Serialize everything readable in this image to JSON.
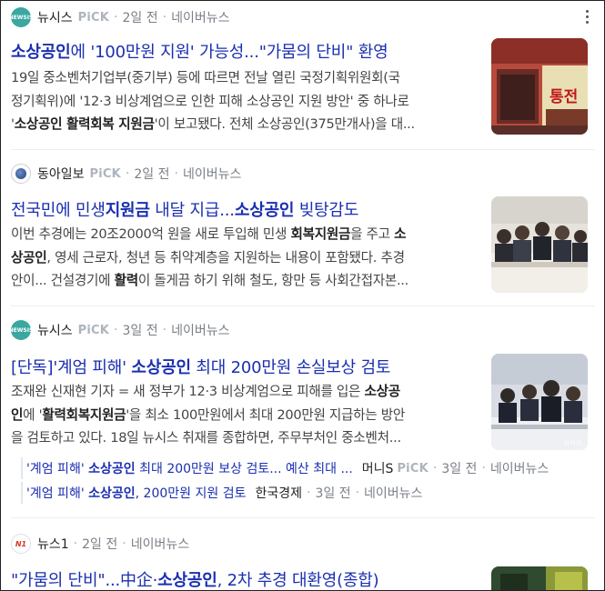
{
  "items": [
    {
      "press": "뉴시스",
      "pick": "PiCK",
      "time": "2일 전",
      "platform": "네이버뉴스",
      "title_parts": [
        "소상공인",
        "에 '100만원 지원' 가능성...\"가뭄의 단비\" 환영"
      ],
      "desc_lines": [
        [
          "19일 중소벤처기업부(중기부) 등에 따르면 전날 열린 국정기획위원회(국"
        ],
        [
          "정기획위)에 '12·3 비상계엄으로 인한 피해 소상공인 지원 방안' 중 하나로"
        ],
        [
          "'",
          "소상공인 활력회복 지원금",
          "'이 보고됐다. 전체 소상공인(375만개사)을 대..."
        ]
      ],
      "thumb_text": "통전"
    },
    {
      "press": "동아일보",
      "pick": "PiCK",
      "time": "2일 전",
      "platform": "네이버뉴스",
      "title_parts": [
        "전국민에 민생",
        "지원금",
        " 내달 지급...",
        "소상공인",
        " 빚탕감도"
      ],
      "desc_lines": [
        [
          "이번 추경에는 20조2000억 원을 새로 투입해 민생 ",
          "회복지원금",
          "을 주고 ",
          "소"
        ],
        [
          "상공인",
          ", 영세 근로자, 청년 등 취약계층을 지원하는 내용이 포함됐다. 추경"
        ],
        [
          "안이... 건설경기에 ",
          "활력",
          "이 돌게끔 하기 위해 철도, 항만 등 사회간접자본..."
        ]
      ]
    },
    {
      "press": "뉴시스",
      "pick": "PiCK",
      "time": "3일 전",
      "platform": "네이버뉴스",
      "title_parts": [
        "[단독]'계엄 피해' ",
        "소상공인",
        " 최대 200만원 손실보상 검토"
      ],
      "desc_lines": [
        [
          "조재완 신재현 기자 = 새 정부가 12·3 비상계엄으로 피해를 입은 ",
          "소상공"
        ],
        [
          "인",
          "에 '",
          "활력회복지원금",
          "'을 최소 100만원에서 최대 200만원 지급하는 방안"
        ],
        [
          "을 검토하고 있다. 18일 뉴시스 취재를 종합하면, 주무부처인 중소벤처..."
        ]
      ],
      "thumb_caption": "뉴시스",
      "related": [
        {
          "title_parts": [
            "'계엄 피해' ",
            "소상공인",
            " 최대 200만원 보상 검토... 예산 최대 ..."
          ],
          "press": "머니S",
          "pick": "PiCK",
          "time": "3일 전",
          "platform": "네이버뉴스"
        },
        {
          "title_parts": [
            "'계엄 피해' ",
            "소상공인",
            ", 200만원 지원 검토"
          ],
          "press": "한국경제",
          "time": "3일 전",
          "platform": "네이버뉴스"
        }
      ]
    },
    {
      "press": "뉴스1",
      "time": "2일 전",
      "platform": "네이버뉴스",
      "title_parts": [
        "\"가뭄의 단비\"...中企·",
        "소상공인",
        ", 2차 추경 대환영(종합)"
      ]
    }
  ]
}
